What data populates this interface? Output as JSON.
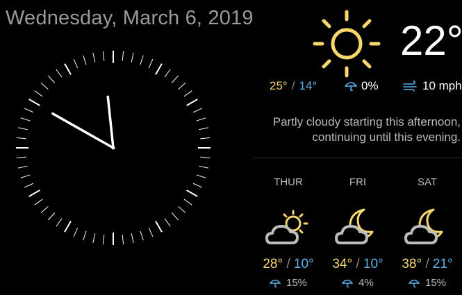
{
  "date": "Wednesday, March 6, 2019",
  "clock": {
    "hour": 9,
    "minute": 59
  },
  "current": {
    "temperature": "22°",
    "high": "25°",
    "low": "14°",
    "temp_separator": "/",
    "precip": "0%",
    "wind": "10 mph",
    "icon": "partly-sunny-icon",
    "summary_line1": "Partly cloudy starting this afternoon,",
    "summary_line2": "continuing until this evening."
  },
  "forecast": [
    {
      "day": "THUR",
      "high": "28°",
      "low": "10°",
      "precip": "15%",
      "icon": "cloud-sun-icon"
    },
    {
      "day": "FRI",
      "high": "34°",
      "low": "10°",
      "precip": "4%",
      "icon": "cloud-moon-icon"
    },
    {
      "day": "SAT",
      "high": "38°",
      "low": "21°",
      "precip": "15%",
      "icon": "cloud-moon-icon"
    }
  ],
  "colors": {
    "sun": "#f7d76c",
    "high_temp": "#f7d76c",
    "low_temp": "#5cb3ef",
    "cloud": "#bdbdbd",
    "background": "#000000"
  }
}
